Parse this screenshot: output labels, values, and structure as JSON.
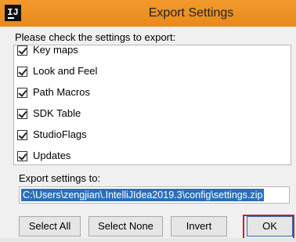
{
  "title": "Export Settings",
  "app_icon_text": "IJ",
  "instruction": "Please check the settings to export:",
  "items": [
    {
      "label": "Key maps",
      "checked": true
    },
    {
      "label": "Look and Feel",
      "checked": true
    },
    {
      "label": "Path Macros",
      "checked": true
    },
    {
      "label": "SDK Table",
      "checked": true
    },
    {
      "label": "StudioFlags",
      "checked": true
    },
    {
      "label": "Updates",
      "checked": true
    }
  ],
  "export_label": "Export settings to:",
  "export_path": "C:\\Users\\zengjian\\.IntelliJIdea2019.3\\config\\settings.zip",
  "buttons": {
    "select_all": "Select All",
    "select_none": "Select None",
    "invert": "Invert",
    "ok": "OK"
  }
}
